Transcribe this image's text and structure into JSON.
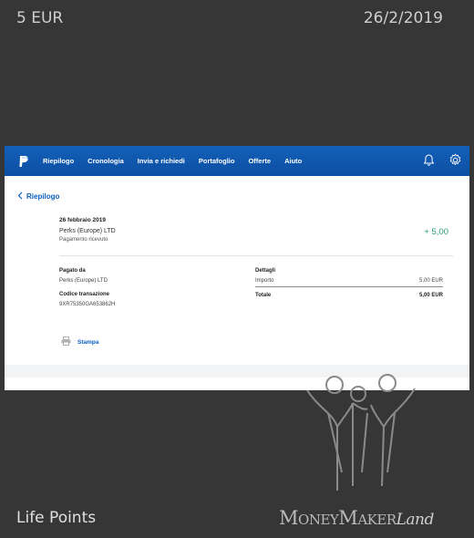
{
  "header": {
    "amount": "5 EUR",
    "date": "26/2/2019"
  },
  "footer": {
    "label": "Life Points",
    "brand_part1": "M",
    "brand_part2": "ONEY",
    "brand_part3": "M",
    "brand_part4": "AKER",
    "brand_part5": "Land"
  },
  "paypal": {
    "nav": {
      "items": [
        "Riepilogo",
        "Cronologia",
        "Invia e richiedi",
        "Portafoglio",
        "Offerte",
        "Aiuto"
      ]
    },
    "back_link": "Riepilogo",
    "transaction": {
      "date": "26 febbraio 2019",
      "merchant": "Perks (Europe) LTD",
      "status": "Pagamento ricevuto",
      "amount": "+ 5,00"
    },
    "paid_by": {
      "label": "Pagato da",
      "value": "Perks (Europe) LTD"
    },
    "transaction_code": {
      "label": "Codice transazione",
      "value": "9XR75350GA653862H"
    },
    "details": {
      "label": "Dettagli",
      "importo_label": "Importo",
      "importo_value": "5,00 EUR",
      "totale_label": "Totale",
      "totale_value": "5,00 EUR"
    },
    "print_label": "Stampa"
  },
  "colors": {
    "navbar": "#0b4fa3",
    "link": "#0a5fc0",
    "amount_positive": "#2a9a7a",
    "background": "#363636"
  }
}
